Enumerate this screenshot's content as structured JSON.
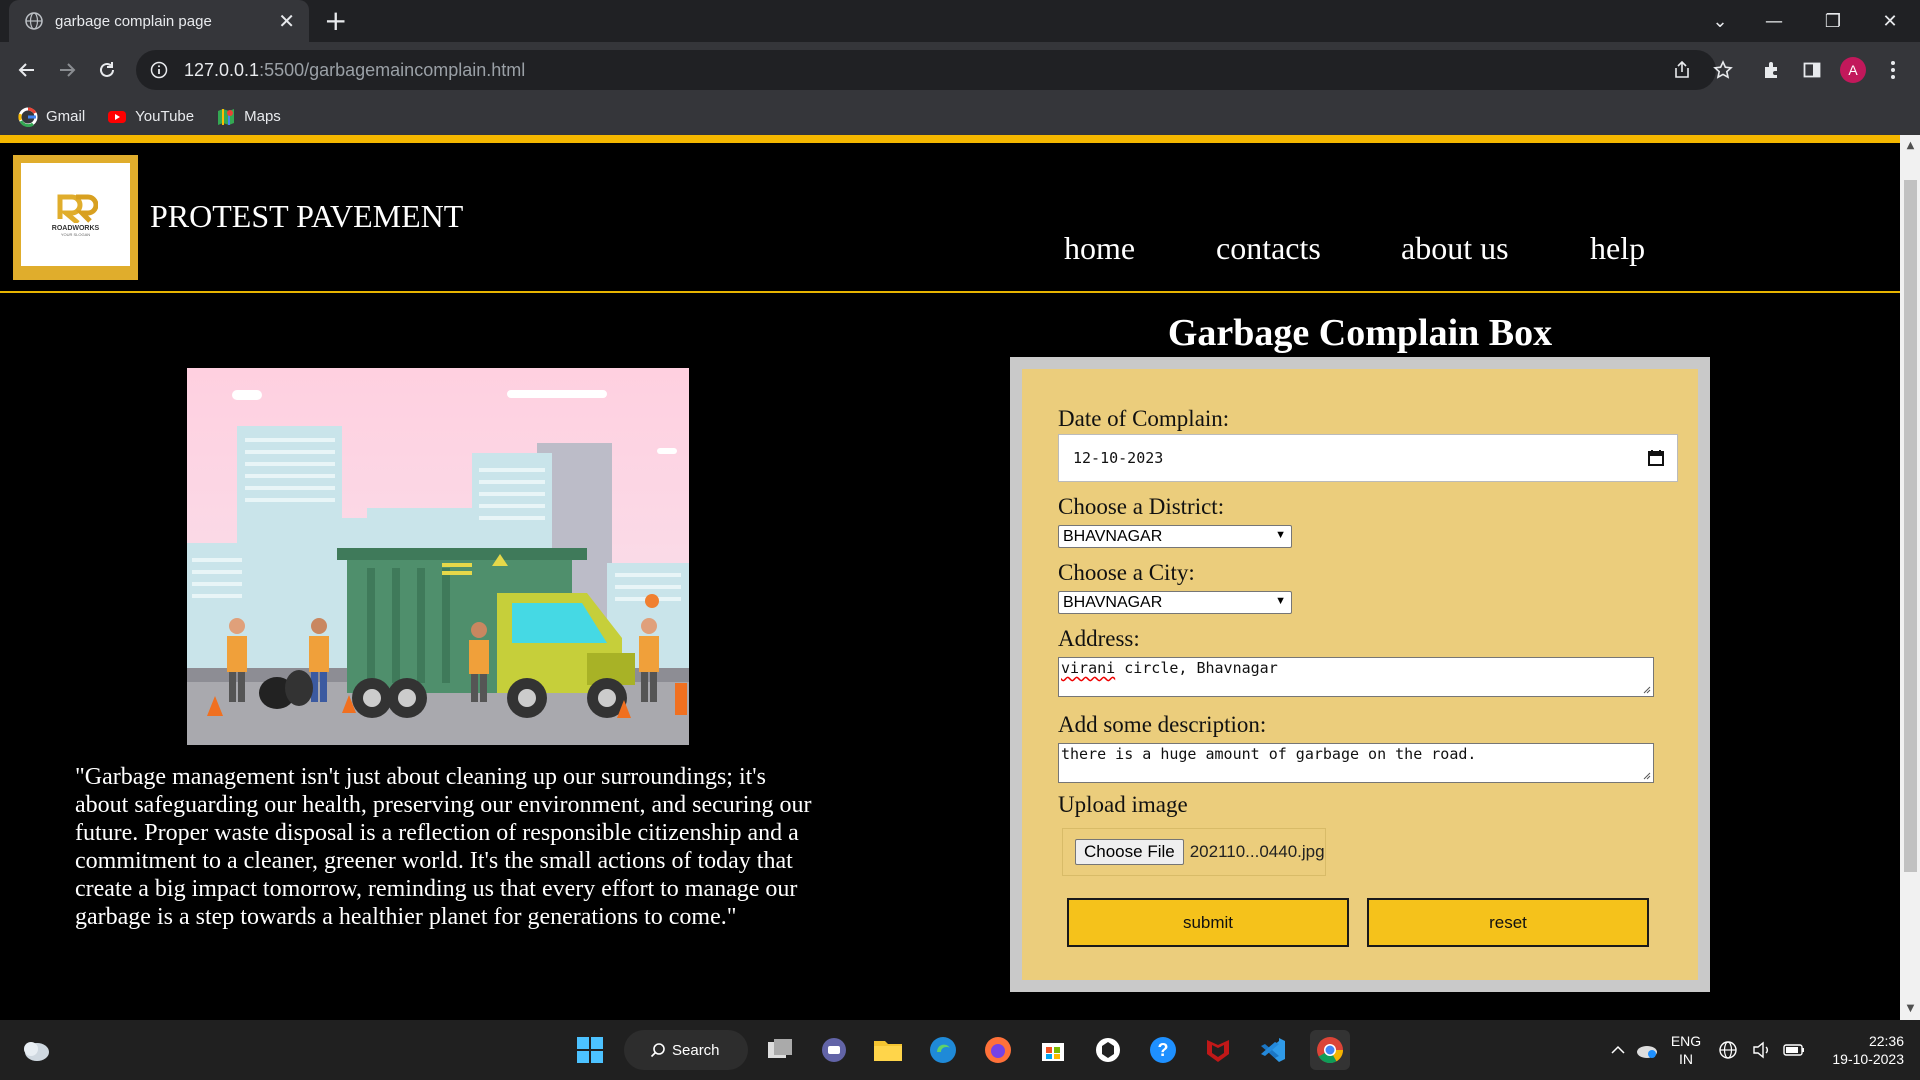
{
  "browser": {
    "tab_title": "garbage complain page",
    "url_host": "127.0.0.1",
    "url_rest": ":5500/garbagemaincomplain.html",
    "bookmarks": [
      {
        "label": "Gmail",
        "icon": "google-icon"
      },
      {
        "label": "YouTube",
        "icon": "youtube-icon"
      },
      {
        "label": "Maps",
        "icon": "maps-icon"
      }
    ],
    "profile_initial": "A"
  },
  "site": {
    "logo": {
      "name": "ROADWORKS",
      "slogan": "YOUR SLOGAN"
    },
    "name": "PROTEST PAVEMENT",
    "nav": [
      "home",
      "contacts",
      "about us",
      "help"
    ],
    "accent_color": "#f5b800"
  },
  "content": {
    "quote": "\"Garbage management isn't just about cleaning up our surroundings; it's about safeguarding our health, preserving our environment, and securing our future. Proper waste disposal is a reflection of responsible citizenship and a commitment to a cleaner, greener world. It's the small actions of today that create a big impact tomorrow, reminding us that every effort to manage our garbage is a step towards a healthier planet for generations to come.\""
  },
  "form": {
    "title": "Garbage Complain Box",
    "date_label": "Date of Complain:",
    "date_value": "12-10-2023",
    "district_label": "Choose a District:",
    "district_value": "BHAVNAGAR",
    "city_label": "Choose a City:",
    "city_value": "BHAVNAGAR",
    "address_label": "Address:",
    "address_word1": "virani",
    "address_rest": " circle, Bhavnagar",
    "description_label": "Add some description:",
    "description_value": "there is a huge amount of garbage on the road.",
    "upload_label": "Upload image",
    "choose_file_label": "Choose File",
    "file_name": "202110...0440.jpg",
    "submit_label": "submit",
    "reset_label": "reset"
  },
  "taskbar": {
    "search_label": "Search",
    "lang_top": "ENG",
    "lang_bottom": "IN",
    "time": "22:36",
    "date": "19-10-2023"
  }
}
